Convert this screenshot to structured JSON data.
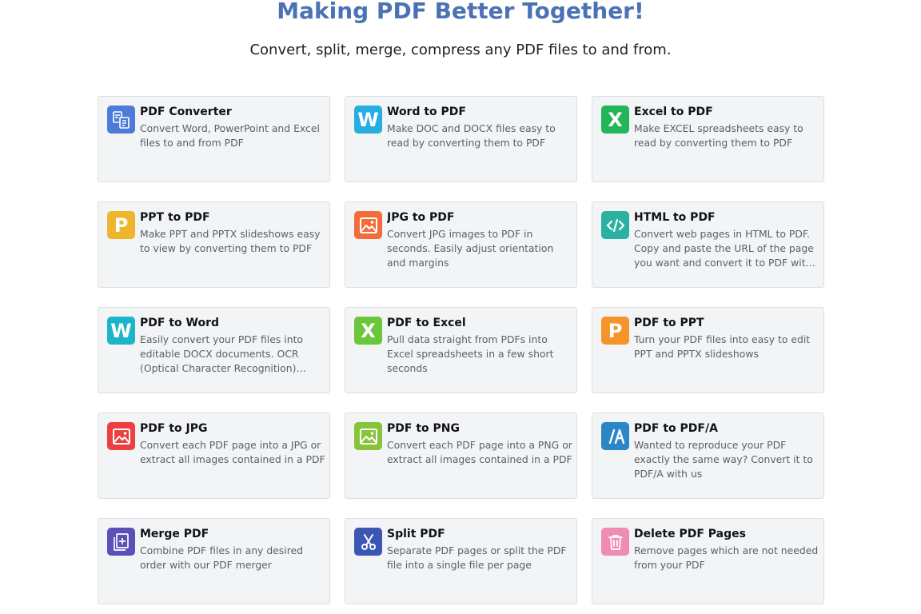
{
  "hero": {
    "title": "Making PDF Better Together!",
    "subtitle": "Convert, split, merge, compress any PDF files to and from."
  },
  "tools": [
    {
      "title": "PDF Converter",
      "desc": "Convert Word, PowerPoint and Excel files to and from PDF",
      "icon": "pdf-converter-icon",
      "color": "#4c7bd9"
    },
    {
      "title": "Word to PDF",
      "desc": "Make DOC and DOCX files easy to read by converting them to PDF",
      "icon": "word-icon",
      "color": "#27aee0"
    },
    {
      "title": "Excel to PDF",
      "desc": "Make EXCEL spreadsheets easy to read by converting them to PDF",
      "icon": "excel-icon",
      "color": "#23b559"
    },
    {
      "title": "PPT to PDF",
      "desc": "Make PPT and PPTX slideshows easy to view by converting them to PDF",
      "icon": "powerpoint-icon",
      "color": "#efb62d"
    },
    {
      "title": "JPG to PDF",
      "desc": "Convert JPG images to PDF in seconds. Easily adjust orientation and margins",
      "icon": "image-icon",
      "color": "#f26d3a"
    },
    {
      "title": "HTML to PDF",
      "desc": "Convert web pages in HTML to PDF. Copy and paste the URL of the page you want and convert it to PDF with a click",
      "icon": "code-icon",
      "color": "#2bb1a1"
    },
    {
      "title": "PDF to Word",
      "desc": "Easily convert your PDF files into editable DOCX documents. OCR (Optical Character Recognition) included",
      "icon": "word-icon",
      "color": "#1cb5c9"
    },
    {
      "title": "PDF to Excel",
      "desc": "Pull data straight from PDFs into Excel spreadsheets in a few short seconds",
      "icon": "excel-icon",
      "color": "#6cc63a"
    },
    {
      "title": "PDF to PPT",
      "desc": "Turn your PDF files into easy to edit PPT and PPTX slideshows",
      "icon": "powerpoint-icon",
      "color": "#f5942a"
    },
    {
      "title": "PDF to JPG",
      "desc": "Convert each PDF page into a JPG or extract all images contained in a PDF",
      "icon": "image-icon",
      "color": "#ee3f3f"
    },
    {
      "title": "PDF to PNG",
      "desc": "Convert each PDF page into a PNG or extract all images contained in a PDF",
      "icon": "image-icon",
      "color": "#87c43a"
    },
    {
      "title": "PDF to PDF/A",
      "desc": "Wanted to reproduce your PDF exactly the same way? Convert it to PDF/A with us",
      "icon": "pdfa-icon",
      "color": "#2b86c5"
    },
    {
      "title": "Merge PDF",
      "desc": "Combine PDF files in any desired order with our PDF merger",
      "icon": "merge-icon",
      "color": "#5b50b8"
    },
    {
      "title": "Split PDF",
      "desc": "Separate PDF pages or split the PDF file into a single file per page",
      "icon": "scissors-icon",
      "color": "#3b56b3"
    },
    {
      "title": "Delete PDF Pages",
      "desc": "Remove pages which are not needed from your PDF",
      "icon": "trash-icon",
      "color": "#f08bb1"
    }
  ]
}
